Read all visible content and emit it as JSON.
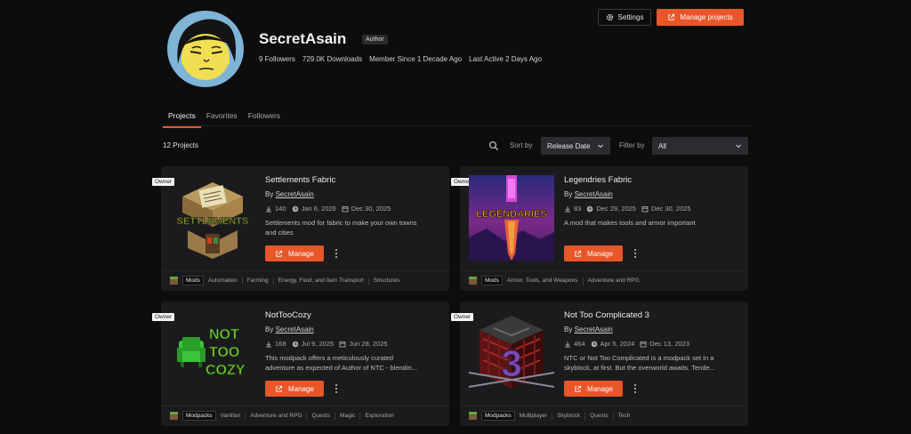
{
  "profile": {
    "name": "SecretAsain",
    "badge": "Author",
    "stats": [
      "9 Followers",
      "729.0K Downloads",
      "Member Since 1 Decade Ago",
      "Last Active 2 Days Ago"
    ]
  },
  "header_buttons": {
    "settings": "Settings",
    "manage_projects": "Manage projects"
  },
  "tabs": [
    "Projects",
    "Favorites",
    "Followers"
  ],
  "toolbar": {
    "count": "12 Projects",
    "sort_label": "Sort by",
    "sort_value": "Release Date",
    "filter_label": "Filter by",
    "filter_value": "All"
  },
  "projects": [
    {
      "owner": "Owner",
      "title": "Settlements Fabric",
      "by": "By",
      "author": "SecretAsain",
      "downloads": "140",
      "released": "Jan 6, 2026",
      "updated": "Dec 30, 2025",
      "desc": [
        "Settlements mod for fabric to make your own towns",
        "and cities"
      ],
      "manage": "Manage",
      "type": "Mods",
      "tags": [
        "Automation",
        "Farming",
        "Energy, Fluid, and Item Transport",
        "Structures"
      ]
    },
    {
      "owner": "Owner",
      "title": "Legendries Fabric",
      "by": "By",
      "author": "SecretAsain",
      "downloads": "83",
      "released": "Dec 29, 2025",
      "updated": "Dec 30, 2025",
      "desc": [
        "A mod that makes tools and armor important",
        ""
      ],
      "manage": "Manage",
      "type": "Mods",
      "tags": [
        "Armor, Tools, and Weapons",
        "Adventure and RPG"
      ]
    },
    {
      "owner": "Owner",
      "title": "NotTooCozy",
      "by": "By",
      "author": "SecretAsain",
      "downloads": "168",
      "released": "Jul 9, 2025",
      "updated": "Jun 28, 2025",
      "desc": [
        "This modpack offers a meticulously curated",
        "adventure as expected of Author of NTC - blendin..."
      ],
      "manage": "Manage",
      "type": "Modpacks",
      "tags": [
        "Vanillan",
        "Adventure and RPG",
        "Quests",
        "Magic",
        "Exploration"
      ]
    },
    {
      "owner": "Owner",
      "title": "Not Too Complicated 3",
      "by": "By",
      "author": "SecretAsain",
      "downloads": "464",
      "released": "Apr 5, 2024",
      "updated": "Dec 13, 2023",
      "desc": [
        "NTC or Not Too Complicated is a modpack set in a",
        "skyblock, at first. But the overworld awaits. Tende..."
      ],
      "manage": "Manage",
      "type": "Modpacks",
      "tags": [
        "Multiplayer",
        "Skyblock",
        "Quests",
        "Tech"
      ]
    }
  ],
  "thumb_text": {
    "settlements": "SETTLEMENTS",
    "legendaries": "LEGENDARIES",
    "cozy": [
      "NOT",
      "TOO",
      "COZY"
    ],
    "ntc": "3"
  },
  "colors": {
    "accent": "#e8562a",
    "background": "#0d0d0e",
    "card": "#1b1b1d"
  }
}
